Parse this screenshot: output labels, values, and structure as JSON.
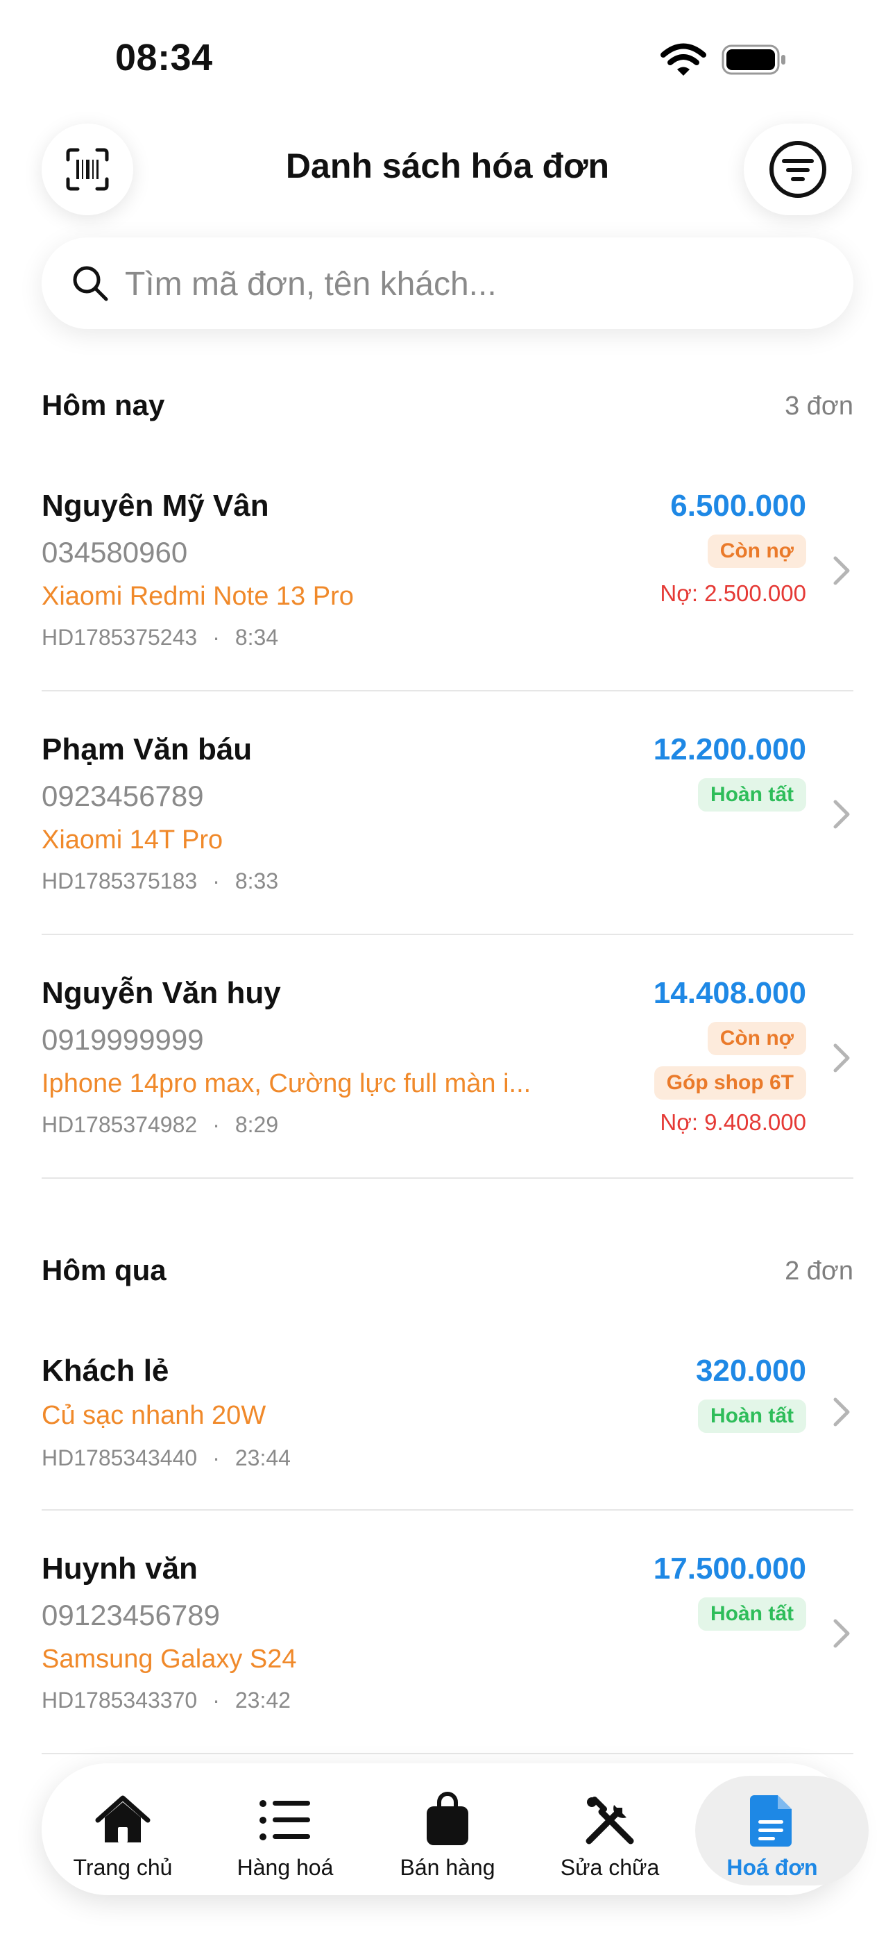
{
  "status_bar": {
    "time": "08:34"
  },
  "header": {
    "title": "Danh sách hóa đơn"
  },
  "search": {
    "placeholder": "Tìm mã đơn, tên khách..."
  },
  "sections": [
    {
      "title": "Hôm nay",
      "count": "3 đơn",
      "invoices": [
        {
          "name": "Nguyên Mỹ Vân",
          "phone": "034580960",
          "product": "Xiaomi Redmi Note 13 Pro",
          "code": "HD1785375243",
          "time": "8:34",
          "amount": "6.500.000",
          "badges": [
            "Còn nợ"
          ],
          "debt": "Nợ: 2.500.000"
        },
        {
          "name": "Phạm Văn báu",
          "phone": "0923456789",
          "product": "Xiaomi 14T Pro",
          "code": "HD1785375183",
          "time": "8:33",
          "amount": "12.200.000",
          "badges": [
            "Hoàn tất"
          ]
        },
        {
          "name": "Nguyễn Văn huy",
          "phone": "0919999999",
          "product": "Iphone 14pro max, Cường lực full màn i...",
          "code": "HD1785374982",
          "time": "8:29",
          "amount": "14.408.000",
          "badges": [
            "Còn nợ",
            "Góp shop 6T"
          ],
          "debt": "Nợ: 9.408.000"
        }
      ]
    },
    {
      "title": "Hôm qua",
      "count": "2 đơn",
      "invoices": [
        {
          "name": "Khách lẻ",
          "product": "Củ sạc nhanh 20W",
          "code": "HD1785343440",
          "time": "23:44",
          "amount": "320.000",
          "badges": [
            "Hoàn tất"
          ]
        },
        {
          "name": "Huynh văn",
          "phone": "09123456789",
          "product": "Samsung Galaxy S24",
          "code": "HD1785343370",
          "time": "23:42",
          "amount": "17.500.000",
          "badges": [
            "Hoàn tất"
          ]
        }
      ]
    }
  ],
  "bottom_nav": [
    {
      "label": "Trang chủ",
      "icon": "home-icon"
    },
    {
      "label": "Hàng hoá",
      "icon": "list-icon"
    },
    {
      "label": "Bán hàng",
      "icon": "shopping-bag-icon"
    },
    {
      "label": "Sửa chữa",
      "icon": "repair-tools-icon"
    },
    {
      "label": "Hoá đơn",
      "icon": "invoice-document-icon",
      "active": true
    }
  ],
  "colors": {
    "accent": "#1e88e5",
    "product_text": "#f0892a",
    "debt_text": "#e53935",
    "badge_debt_bg": "#fdebdc",
    "badge_debt_text": "#ea7a2a",
    "badge_done_bg": "#e3f6e8",
    "badge_done_text": "#2ebd5a"
  }
}
